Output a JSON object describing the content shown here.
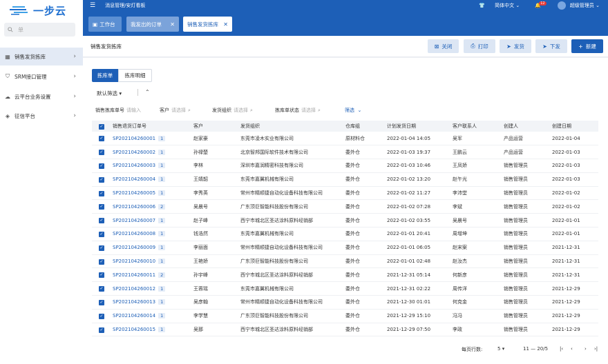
{
  "sidebar": {
    "logo_text": "一步云",
    "search_placeholder": "单",
    "items": [
      {
        "label": "销售发货拣库",
        "icon": "grid-icon"
      },
      {
        "label": "SRM接口管理",
        "icon": "shield-icon"
      },
      {
        "label": "云平台业务设置",
        "icon": "cloud-icon"
      },
      {
        "label": "征信平台",
        "icon": "shield-check-icon"
      }
    ]
  },
  "topbar": {
    "breadcrumb": "消息管理/安灯看板",
    "language": "简体中文",
    "notification_count": "12",
    "user": "超级管理员"
  },
  "tabs": [
    {
      "label": "工作台"
    },
    {
      "label": "我发出的订单"
    },
    {
      "label": "销售发货拣库"
    }
  ],
  "toolbar": {
    "title": "销售发货拣库",
    "close": "关闭",
    "print": "打印",
    "ship": "发货",
    "dispatch": "下发",
    "new": "新建"
  },
  "subtabs": {
    "pick_order": "拣库单",
    "pick_detail": "拣库明细"
  },
  "filter_preset": "默认筛选",
  "filters": {
    "order_no_label": "销售拣库单号",
    "order_no_placeholder": "请输入",
    "customer_label": "客户",
    "customer_placeholder": "请选择",
    "org_label": "发货组织",
    "org_placeholder": "请选择",
    "status_label": "拣库单状态",
    "status_placeholder": "请选择",
    "filter_link": "筛选"
  },
  "table": {
    "headers": [
      "销售退货订单号",
      "客户",
      "发货组织",
      "仓库组",
      "计划发货日期",
      "客户联系人",
      "创建人",
      "创建日期"
    ],
    "rows": [
      {
        "code": "SP202104260001",
        "badge": "1",
        "customer": "赵家豪",
        "org": "东莞市凌木实业有限公司",
        "wh": "原材料仓",
        "plan": "2022-01-04 14:05",
        "contact": "吴军",
        "creator": "产品运营",
        "created": "2022-01-04"
      },
      {
        "code": "SP202104260002",
        "badge": "1",
        "customer": "孙禄楚",
        "org": "北京智邦国际软件技术有限公司",
        "wh": "委外仓",
        "plan": "2022-01-03 19:37",
        "contact": "王鹏云",
        "creator": "产品运营",
        "created": "2022-01-03"
      },
      {
        "code": "SP202104260003",
        "badge": "1",
        "customer": "李林",
        "org": "深圳市嘉润精密科技有限公司",
        "wh": "委外仓",
        "plan": "2022-01-03 10:46",
        "contact": "王凤娇",
        "creator": "销售管理员",
        "created": "2022-01-03"
      },
      {
        "code": "SP202104260004",
        "badge": "1",
        "customer": "王婧韶",
        "org": "东莞市嘉翼机械有限公司",
        "wh": "委外仓",
        "plan": "2022-01-02 13:20",
        "contact": "赵午光",
        "creator": "销售管理员",
        "created": "2022-01-03"
      },
      {
        "code": "SP202104260005",
        "badge": "1",
        "customer": "李秀英",
        "org": "常州市精顺捷自动化设备科技有限公司",
        "wh": "委外仓",
        "plan": "2022-01-02 11:27",
        "contact": "李沛堂",
        "creator": "销售管理员",
        "created": "2022-01-02"
      },
      {
        "code": "SP202104260006",
        "badge": "2",
        "customer": "吴晨号",
        "org": "广东顶巨智能科技股份有限公司",
        "wh": "委外仓",
        "plan": "2022-01-02 07:28",
        "contact": "李斌",
        "creator": "销售管理员",
        "created": "2022-01-02"
      },
      {
        "code": "SP202104260007",
        "badge": "1",
        "customer": "赵子峰",
        "org": "西宁市城北区圣达涂料原料经销部",
        "wh": "委外仓",
        "plan": "2022-01-02 03:55",
        "contact": "吴晨号",
        "creator": "销售管理员",
        "created": "2022-01-01"
      },
      {
        "code": "SP202104260008",
        "badge": "1",
        "customer": "钱浩然",
        "org": "东莞市嘉翼机械有限公司",
        "wh": "委外仓",
        "plan": "2022-01-01 20:41",
        "contact": "周增坤",
        "creator": "销售管理员",
        "created": "2022-01-01"
      },
      {
        "code": "SP202104260009",
        "badge": "1",
        "customer": "李丽面",
        "org": "常州市精顺捷自动化设备科技有限公司",
        "wh": "委外仓",
        "plan": "2022-01-01 06:05",
        "contact": "赵宋案",
        "creator": "销售管理员",
        "created": "2021-12-31"
      },
      {
        "code": "SP202104260010",
        "badge": "1",
        "customer": "王艳娇",
        "org": "广东顶巨智能科技股份有限公司",
        "wh": "委外仓",
        "plan": "2022-01-01 02:48",
        "contact": "赵汝杰",
        "creator": "销售管理员",
        "created": "2021-12-31"
      },
      {
        "code": "SP202104260011",
        "badge": "2",
        "customer": "孙宇峰",
        "org": "西宁市城北区圣达涂料原料经销部",
        "wh": "委外仓",
        "plan": "2021-12-31 05:14",
        "contact": "何新彦",
        "creator": "销售管理员",
        "created": "2021-12-31"
      },
      {
        "code": "SP202104260012",
        "badge": "1",
        "customer": "王蓉瑶",
        "org": "东莞市嘉翼机械有限公司",
        "wh": "委外仓",
        "plan": "2021-12-31 02:22",
        "contact": "周传洋",
        "creator": "销售管理员",
        "created": "2021-12-29"
      },
      {
        "code": "SP202104260013",
        "badge": "1",
        "customer": "吴彦翰",
        "org": "常州市精顺捷自动化设备科技有限公司",
        "wh": "委外仓",
        "plan": "2021-12-30 01:01",
        "contact": "何克金",
        "creator": "销售管理员",
        "created": "2021-12-29"
      },
      {
        "code": "SP202104260014",
        "badge": "1",
        "customer": "李学慧",
        "org": "广东顶巨智能科技股份有限公司",
        "wh": "委外仓",
        "plan": "2021-12-29 15:10",
        "contact": "冯冯",
        "creator": "销售管理员",
        "created": "2021-12-29"
      },
      {
        "code": "SP202104260015",
        "badge": "1",
        "customer": "吴那",
        "org": "西宁市城北区圣达涂料原料经销部",
        "wh": "委外仓",
        "plan": "2021-12-29 07:50",
        "contact": "李政",
        "creator": "销售管理员",
        "created": "2021-12-29"
      }
    ]
  },
  "pager": {
    "rows_label": "每页行数:",
    "rows_value": "5",
    "range": "11 — 20/5"
  },
  "colors": {
    "primary": "#1d5fb7",
    "header_bg": "#1d5fb7",
    "active_menu": "#e3eaf5"
  }
}
